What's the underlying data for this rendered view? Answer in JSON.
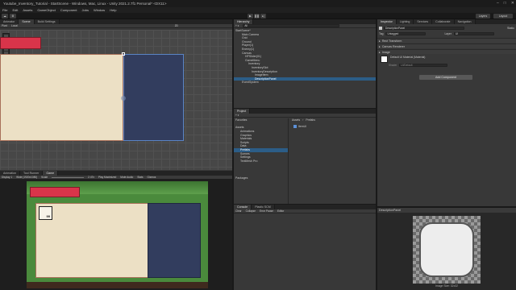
{
  "window": {
    "title": "Youtube_Inventory_Tutorial - StartScene - Windows, Mac, Linux - Unity 2021.2.7f1 Personal* <DX11>",
    "controls": [
      "–",
      "□",
      "✕"
    ]
  },
  "menu": [
    "File",
    "Edit",
    "Assets",
    "GameObject",
    "Component",
    "Jobs",
    "Window",
    "Help"
  ],
  "toolbar": {
    "account": "Layers",
    "layout": "Layout"
  },
  "scene_tabs": [
    "Animator",
    "Scene",
    "Build Settings"
  ],
  "scene_toolbar": [
    "Pivot",
    "Local",
    "2D"
  ],
  "scene": {
    "slot_count": "99"
  },
  "game_tabs": [
    "Animation",
    "Tool Runner",
    "Game"
  ],
  "game_toolbar": {
    "display": "Display 1",
    "resolution": "Wide (1920x1080)",
    "scale_label": "Scale",
    "scale_value": "2.47x",
    "play_mode": "Play Maximized",
    "mute": "Mute Audio",
    "stats": "Stats",
    "gizmos": "Gizmos"
  },
  "game": {
    "slot_count": "99"
  },
  "hierarchy": {
    "tab": "Hierarchy",
    "search_placeholder": "All",
    "items": [
      {
        "label": "StartScene*",
        "indent": 0
      },
      {
        "label": "Main Camera",
        "indent": 2
      },
      {
        "label": "Grid",
        "indent": 2
      },
      {
        "label": "Ground",
        "indent": 2
      },
      {
        "label": "Player(1)",
        "indent": 2
      },
      {
        "label": "Enemy(1)",
        "indent": 2
      },
      {
        "label": "Canvas",
        "indent": 2
      },
      {
        "label": "HPSlider(01)",
        "indent": 3
      },
      {
        "label": "GameMenu",
        "indent": 3
      },
      {
        "label": "Inventory",
        "indent": 4
      },
      {
        "label": "InventorySlot",
        "indent": 5
      },
      {
        "label": "InventoryDescription",
        "indent": 5
      },
      {
        "label": "ImageItem",
        "indent": 6
      },
      {
        "label": "DescriptionPanel",
        "indent": 6
      },
      {
        "label": "EventSystem",
        "indent": 2
      }
    ],
    "selected_index": 13
  },
  "inspector": {
    "tabs": [
      "Inspector",
      "Lighting",
      "Services",
      "Collaborate",
      "Navigation"
    ],
    "object_name": "DescriptionPanel",
    "static_label": "Static",
    "tag_label": "Tag",
    "tag_value": "Untagged",
    "layer_label": "Layer",
    "layer_value": "UI",
    "components": [
      "Rect Transform",
      "Canvas Renderer",
      "Image"
    ],
    "material_label": "Default UI Material (Material)",
    "shader_label": "Shader",
    "shader_value": "UI/Default",
    "add_component": "Add Component"
  },
  "project": {
    "tab": "Project",
    "favorites": "Favorites",
    "assets_root": "Assets",
    "folders": [
      "Animations",
      "Graphics",
      "Materials",
      "Scripts",
      "Data",
      "Prefabs",
      "Scenes",
      "Settings",
      "TextMesh Pro"
    ],
    "selected_folder_index": 5,
    "packages": "Packages",
    "breadcrumb": [
      "Assets",
      "Prefabs"
    ],
    "files": [
      "ItemUI"
    ]
  },
  "console": {
    "tabs": [
      "Console",
      "Plastic SCM"
    ],
    "buttons": [
      "Clear",
      "Collapse",
      "Error Pause",
      "Editor"
    ]
  },
  "preview": {
    "title": "DescriptionPanel",
    "caption": "Image Size: 32x32"
  },
  "colors": {
    "cream": "#ece0c5",
    "navy": "#323d5e",
    "red": "#d9344a",
    "selection": "#2c5d87",
    "grass": "#4a8a3c"
  }
}
